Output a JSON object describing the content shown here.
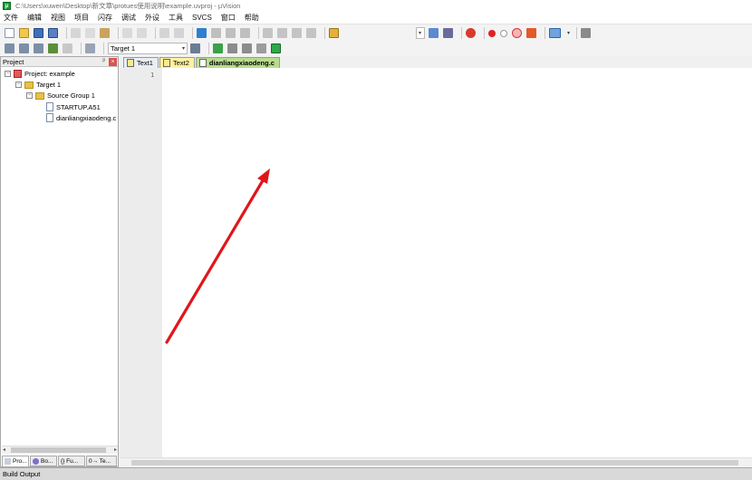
{
  "window": {
    "title": "C:\\Users\\xuwen\\Desktop\\新文章\\protues使用说明\\example.uvproj - µVision"
  },
  "menu": [
    "文件",
    "编辑",
    "视图",
    "项目",
    "闪存",
    "调试",
    "外设",
    "工具",
    "SVCS",
    "窗口",
    "帮助"
  ],
  "toolbar2": {
    "target_select": "Target 1"
  },
  "project_panel": {
    "title": "Project",
    "pin_label": "ᵖ",
    "close_label": "×",
    "tree": {
      "project": "Project: example",
      "target": "Target 1",
      "group": "Source Group 1",
      "files": [
        "STARTUP.A51",
        "dianliangxiaodeng.c"
      ]
    },
    "tabs": [
      "Pro...",
      "Bo...",
      "{} Fu...",
      "0→ Te..."
    ]
  },
  "editor": {
    "tabs": [
      "Text1",
      "Text2",
      "dianliangxiaodeng.c"
    ],
    "line_numbers": [
      "1"
    ]
  },
  "status": {
    "build_output": "Build Output"
  },
  "colors": {
    "annotation_arrow": "#e0161b",
    "active_tab": "#b8dc8e",
    "modified_tab": "#fdf2a0"
  },
  "annotation": {
    "type": "red-arrow",
    "icon": "arrow-up-right"
  }
}
